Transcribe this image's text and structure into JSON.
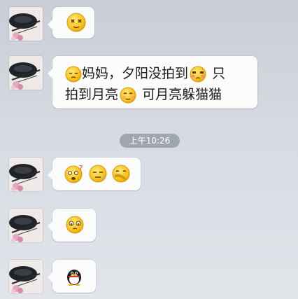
{
  "messages": [
    {
      "type": "emoji",
      "emojis": [
        "emoji-dizzy"
      ]
    },
    {
      "type": "text",
      "line1": "妈妈，夕阳没拍到",
      "line1_tail": "只",
      "line2a": "拍到月亮",
      "line2b": "可月亮躲猫猫"
    },
    {
      "type": "timestamp",
      "text": "上午10:26"
    },
    {
      "type": "emoji",
      "emojis": [
        "emoji-question",
        "emoji-sweat",
        "emoji-cover-face"
      ]
    },
    {
      "type": "emoji",
      "emojis": [
        "emoji-teary"
      ]
    },
    {
      "type": "emoji",
      "emojis": [
        "emoji-penguin"
      ]
    }
  ],
  "colors": {
    "bubble": "#fbfbfb",
    "text": "#1c1c1c",
    "timestamp_bg": "#969ca6"
  }
}
